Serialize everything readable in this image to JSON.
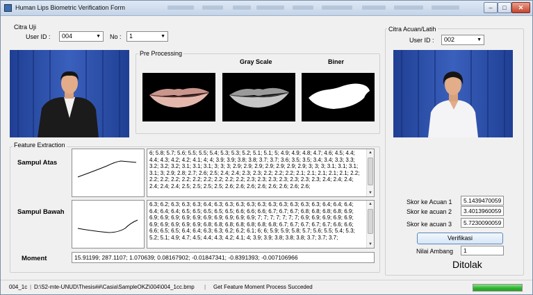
{
  "window": {
    "title": "Human Lips Biometric Verification Form",
    "buttons": {
      "minimize": "–",
      "maximize": "□",
      "close": "✕"
    }
  },
  "citra_uji": {
    "group_label": "Citra Uji",
    "user_id_label": "User ID :",
    "user_id_value": "004",
    "no_label": "No :",
    "no_value": "1"
  },
  "pre_processing": {
    "group_label": "Pre Processing",
    "gray_scale_label": "Gray Scale",
    "biner_label": "Biner"
  },
  "citra_acuan": {
    "group_label": "Citra Acuan/Latih",
    "user_id_label": "User ID :",
    "user_id_value": "002"
  },
  "feature_extraction": {
    "group_label": "Feature Extraction",
    "sampul_atas_label": "Sampul Atas",
    "sampul_atas_text": "6; 5.8; 5.7; 5.6; 5.5; 5.5; 5.4; 5.3; 5.3; 5.2; 5.1; 5.1; 5; 4.9; 4.9; 4.8; 4.7; 4.6; 4.5; 4.4; 4.4; 4.3; 4.2; 4.2; 4.1; 4; 4; 3.9; 3.9; 3.8; 3.8; 3.7; 3.7; 3.6; 3.5; 3.5; 3.4; 3.4; 3.3; 3.3; 3.2; 3.2; 3.2; 3.1; 3.1; 3.1; 3; 3; 3; 2.9; 2.9; 2.9; 2.9; 2.9; 2.9; 2.9; 3; 3; 3; 3.1; 3.1; 3.1; 3.1; 3; 2.9; 2.8; 2.7; 2.6; 2.5; 2.4; 2.4; 2.3; 2.3; 2.2; 2.2; 2.2; 2.1; 2.1; 2.1; 2.1; 2.1; 2.2; 2.2; 2.2; 2.2; 2.2; 2.2; 2.2; 2.2; 2.2; 2.2; 2.3; 2.3; 2.3; 2.3; 2.3; 2.3; 2.3; 2.4; 2.4; 2.4; 2.4; 2.4; 2.4; 2.5; 2.5; 2.5; 2.5; 2.6; 2.6; 2.6; 2.6; 2.6; 2.6; 2.6; 2.6;",
    "sampul_bawah_label": "Sampul Bawah",
    "sampul_bawah_text": "6.3; 6.2; 6.3; 6.3; 6.3; 6.4; 6.3; 6.3; 6.3; 6.3; 6.3; 6.3; 6.3; 6.3; 6.3; 6.3; 6.4; 6.4; 6.4; 6.4; 6.4; 6.4; 6.5; 6.5; 6.5; 6.5; 6.5; 6.6; 6.6; 6.6; 6.7; 6.7; 6.7; 6.8; 6.8; 6.8; 6.8; 6.9; 6.9; 6.9; 6.9; 6.9; 6.9; 6.9; 6.9; 6.9; 6.9; 6.9; 7; 7; 7; 7; 7; 7; 7; 6.9; 6.9; 6.9; 6.9; 6.9; 6.9; 6.9; 6.9; 6.9; 6.9; 6.8; 6.8; 6.8; 6.8; 6.8; 6.8; 6.8; 6.7; 6.7; 6.7; 6.7; 6.7; 6.6; 6.6; 6.6; 6.5; 6.5; 6.4; 6.4; 6.3; 6.3; 6.2; 6.2; 6.1; 6; 6; 5.9; 5.9; 5.8; 5.7; 5.6; 5.5; 5.4; 5.3; 5.2; 5.1; 4.9; 4.7; 4.5; 4.4; 4.3; 4.2; 4.1; 4; 3.9; 3.9; 3.8; 3.8; 3.8; 3.7; 3.7; 3.7;",
    "moment_label": "Moment",
    "moment_value": "15.91199; 287.1107; 1.070639; 0.08167902; -0.01847341; -0.8391393; -0.007106966"
  },
  "scores": {
    "skor1_label": "Skor ke Acuan 1",
    "skor1_value": "5.1439470059",
    "skor2_label": "Skor ke acuan 2",
    "skor2_value": "3.4013960059",
    "skor3_label": "Skor ke acuan 3",
    "skor3_value": "5.7230090059",
    "verifikasi_button": "Verifikasi",
    "nilai_ambang_label": "Nilai Ambang",
    "nilai_ambang_value": "1",
    "result": "Ditolak"
  },
  "statusbar": {
    "file_id": "004_1c",
    "path": "D:\\S2-mte-UNUD\\Thesis##\\Casia\\SampleOKZ\\004\\004_1cc.bmp",
    "message": "Get Feature Moment Process Succeded",
    "progress_percent": 100
  },
  "colors": {
    "photo_background": "#2a4fa8",
    "progress_fill": "#2eb52e"
  }
}
